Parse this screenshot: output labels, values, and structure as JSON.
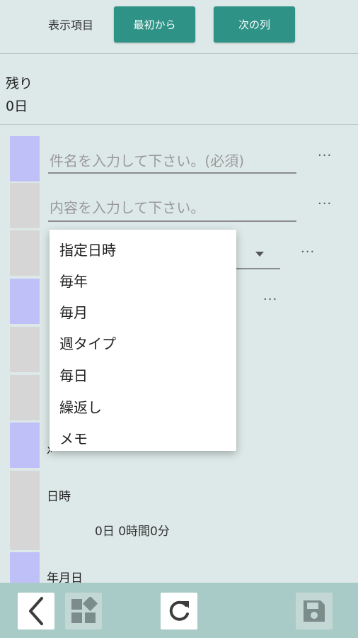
{
  "header": {
    "label": "表示項目",
    "first_button": "最初から",
    "next_button": "次の列"
  },
  "remaining": {
    "label": "残り",
    "value": "0日"
  },
  "fields": {
    "title_placeholder": "件名を入力して下さい。(必須)",
    "content_placeholder": "内容を入力して下さい。",
    "more": "···"
  },
  "dropdown": {
    "items": [
      "指定日時",
      "毎年",
      "毎月",
      "週タイプ",
      "毎日",
      "繰返し",
      "メモ"
    ]
  },
  "section": {
    "partial_label": "ﾒ",
    "datetime_label": "日時",
    "duration": "0日 0時間0分",
    "date_label": "年月日"
  },
  "colors": {
    "accent": "#2e9287",
    "swatch_blue": "#bfc0f7",
    "swatch_gray": "#d6d6d6",
    "bottom_bar": "#a9cbc7"
  },
  "toolbar_icons": [
    "back-icon",
    "grid-icon",
    "refresh-icon",
    "save-icon"
  ]
}
